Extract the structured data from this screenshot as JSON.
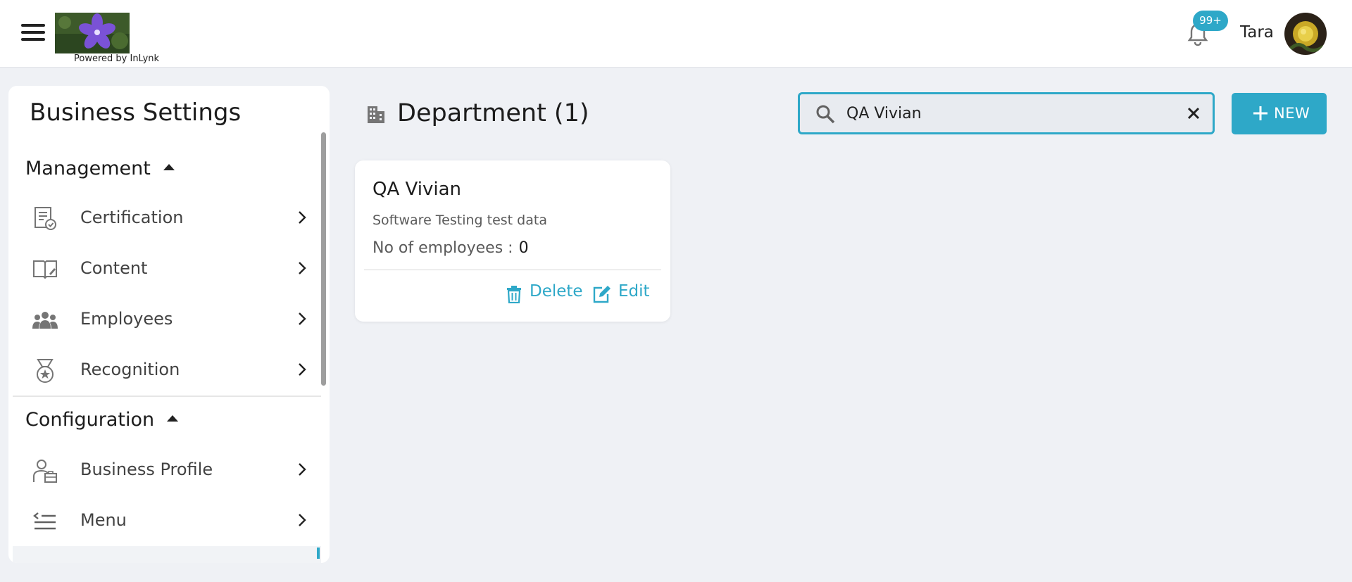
{
  "header": {
    "powered_by": "Powered by InLynk",
    "notifications_badge": "99+",
    "user_name": "Tara",
    "colors": {
      "accent": "#2ea8c8",
      "background": "#eff1f5"
    }
  },
  "sidebar": {
    "title": "Business Settings",
    "sections": [
      {
        "label": "Management",
        "items": [
          {
            "label": "Certification",
            "icon": "certificate-icon"
          },
          {
            "label": "Content",
            "icon": "book-edit-icon"
          },
          {
            "label": "Employees",
            "icon": "group-icon"
          },
          {
            "label": "Recognition",
            "icon": "medal-icon"
          }
        ]
      },
      {
        "label": "Configuration",
        "items": [
          {
            "label": "Business Profile",
            "icon": "business-person-icon"
          },
          {
            "label": "Menu",
            "icon": "menu-list-icon"
          }
        ]
      }
    ]
  },
  "main": {
    "title": "Department (1)",
    "search": {
      "value": "QA Vivian",
      "placeholder": "Search"
    },
    "new_button": "NEW",
    "cards": [
      {
        "name": "QA Vivian",
        "description": "Software Testing test data",
        "employees_label": "No of employees :",
        "employees_count": "0",
        "delete_label": "Delete",
        "edit_label": "Edit"
      }
    ]
  }
}
